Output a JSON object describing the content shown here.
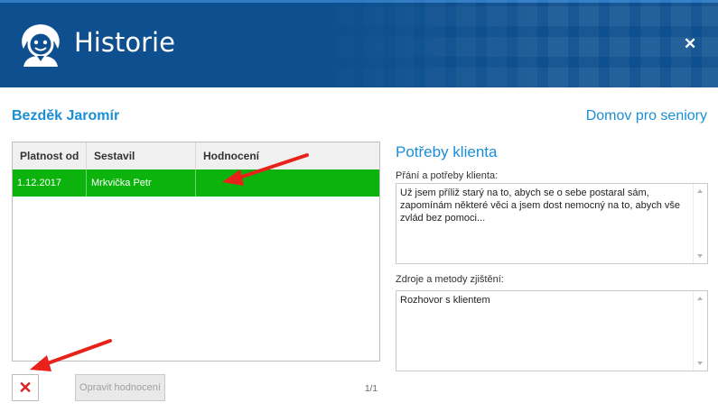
{
  "window": {
    "title": "Historie",
    "close_glyph": "✕"
  },
  "client": {
    "name": "Bezděk Jaromír",
    "facility": "Domov pro seniory"
  },
  "history_table": {
    "columns": [
      "Platnost od",
      "Sestavil",
      "Hodnocení"
    ],
    "rows": [
      {
        "platnost_od": "1.12.2017",
        "sestavil": "Mrkvička Petr",
        "hodnoceni": ""
      }
    ],
    "selected_row_color": "#0db30d"
  },
  "actions": {
    "delete_glyph": "✕",
    "edit_label": "Opravit hodnocení"
  },
  "pager": {
    "text": "1/1"
  },
  "needs": {
    "title": "Potřeby klienta",
    "wishes_label": "Přání a potřeby klienta:",
    "wishes_text": "Už jsem příliž starý na to, abych se o sebe postaral sám, zapomínám některé věci a jsem dost nemocný na to, abych vše zvlád bez pomoci...",
    "sources_label": "Zdroje a metody zjištění:",
    "sources_text": "Rozhovor s klientem"
  },
  "colors": {
    "header": "#0d4f8f",
    "accent": "#1a8fd6",
    "annotation_arrow": "#e8221b"
  },
  "icons": {
    "logo": "user-avatar-icon",
    "close": "close-icon",
    "delete": "delete-x-icon"
  }
}
